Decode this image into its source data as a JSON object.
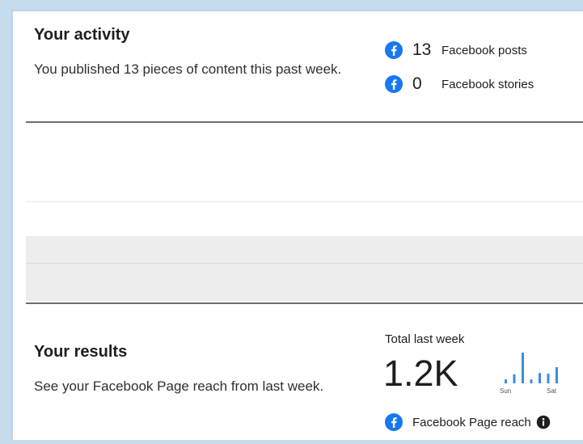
{
  "activity": {
    "title": "Your activity",
    "description": "You published 13 pieces of content this past week.",
    "stats": [
      {
        "value": "13",
        "label": "Facebook posts",
        "icon": "facebook-icon"
      },
      {
        "value": "0",
        "label": "Facebook stories",
        "icon": "facebook-icon"
      }
    ]
  },
  "results": {
    "title": "Your results",
    "description": "See your Facebook Page reach from last week.",
    "total_label": "Total last week",
    "total_value": "1.2K",
    "spark_start_label": "Sun",
    "spark_end_label": "Sat",
    "spark_values": [
      0.12,
      0.28,
      0.95,
      0.12,
      0.32,
      0.3,
      0.5
    ],
    "reach_label": "Facebook Page reach",
    "reach_icon": "facebook-icon",
    "info_icon": "info-icon"
  },
  "colors": {
    "accent": "#1877f2",
    "spark": "#3b8ed9",
    "page_background": "#c6dbee"
  }
}
